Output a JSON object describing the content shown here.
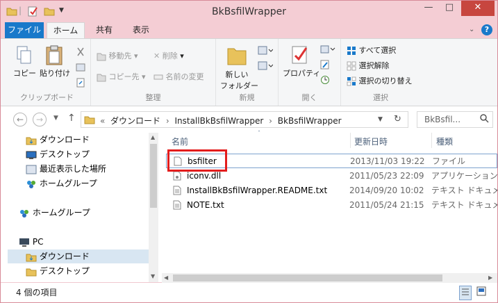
{
  "window": {
    "title": "BkBsfilWrapper",
    "minimize": "—",
    "maximize": "□",
    "close": "✕"
  },
  "ribbon_tabs": [
    "ファイル",
    "ホーム",
    "共有",
    "表示"
  ],
  "ribbon": {
    "clipboard": {
      "copy": "コピー",
      "paste": "貼り付け",
      "label": "クリップボード"
    },
    "organize": {
      "move_to": "移動先",
      "copy_to": "コピー先",
      "delete": "削除",
      "rename": "名前の変更",
      "label": "整理"
    },
    "new": {
      "new_folder_line1": "新しい",
      "new_folder_line2": "フォルダー",
      "label": "新規"
    },
    "open": {
      "properties": "プロパティ",
      "label": "開く"
    },
    "select": {
      "select_all": "すべて選択",
      "select_none": "選択解除",
      "invert": "選択の切り替え",
      "label": "選択"
    }
  },
  "address": {
    "prefix": "«",
    "parts": [
      "ダウンロード",
      "InstallBkBsfilWrapper",
      "BkBsfilWrapper"
    ],
    "sep": "›"
  },
  "search": {
    "placeholder": "BkBsfil..."
  },
  "nav_pane": [
    "ダウンロード",
    "デスクトップ",
    "最近表示した場所",
    "ホームグループ",
    "ホームグループ",
    "PC",
    "ダウンロード",
    "デスクトップ"
  ],
  "columns": {
    "name": "名前",
    "date": "更新日時",
    "type": "種類"
  },
  "files": [
    {
      "name": "bsfilter",
      "date": "2013/11/03 19:22",
      "type": "ファイル"
    },
    {
      "name": "iconv.dll",
      "date": "2011/05/23 22:09",
      "type": "アプリケーション拡張"
    },
    {
      "name": "InstallBkBsfilWrapper.README.txt",
      "date": "2014/09/20 10:02",
      "type": "テキスト ドキュメント"
    },
    {
      "name": "NOTE.txt",
      "date": "2011/05/24 21:15",
      "type": "テキスト ドキュメント"
    }
  ],
  "status": "4 個の項目",
  "colors": {
    "accent": "#1979ca",
    "titlebar": "#f4cdd4",
    "highlight": "#e31c1c"
  }
}
